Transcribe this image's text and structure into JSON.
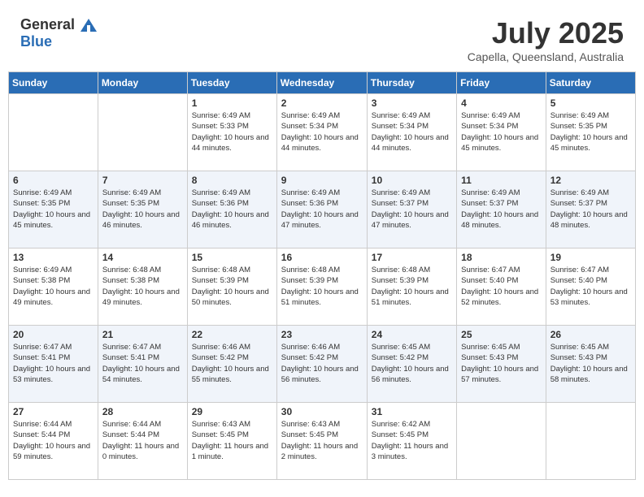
{
  "header": {
    "logo_general": "General",
    "logo_blue": "Blue",
    "month": "July 2025",
    "location": "Capella, Queensland, Australia"
  },
  "weekdays": [
    "Sunday",
    "Monday",
    "Tuesday",
    "Wednesday",
    "Thursday",
    "Friday",
    "Saturday"
  ],
  "weeks": [
    [
      {
        "day": "",
        "info": ""
      },
      {
        "day": "",
        "info": ""
      },
      {
        "day": "1",
        "info": "Sunrise: 6:49 AM\nSunset: 5:33 PM\nDaylight: 10 hours and 44 minutes."
      },
      {
        "day": "2",
        "info": "Sunrise: 6:49 AM\nSunset: 5:34 PM\nDaylight: 10 hours and 44 minutes."
      },
      {
        "day": "3",
        "info": "Sunrise: 6:49 AM\nSunset: 5:34 PM\nDaylight: 10 hours and 44 minutes."
      },
      {
        "day": "4",
        "info": "Sunrise: 6:49 AM\nSunset: 5:34 PM\nDaylight: 10 hours and 45 minutes."
      },
      {
        "day": "5",
        "info": "Sunrise: 6:49 AM\nSunset: 5:35 PM\nDaylight: 10 hours and 45 minutes."
      }
    ],
    [
      {
        "day": "6",
        "info": "Sunrise: 6:49 AM\nSunset: 5:35 PM\nDaylight: 10 hours and 45 minutes."
      },
      {
        "day": "7",
        "info": "Sunrise: 6:49 AM\nSunset: 5:35 PM\nDaylight: 10 hours and 46 minutes."
      },
      {
        "day": "8",
        "info": "Sunrise: 6:49 AM\nSunset: 5:36 PM\nDaylight: 10 hours and 46 minutes."
      },
      {
        "day": "9",
        "info": "Sunrise: 6:49 AM\nSunset: 5:36 PM\nDaylight: 10 hours and 47 minutes."
      },
      {
        "day": "10",
        "info": "Sunrise: 6:49 AM\nSunset: 5:37 PM\nDaylight: 10 hours and 47 minutes."
      },
      {
        "day": "11",
        "info": "Sunrise: 6:49 AM\nSunset: 5:37 PM\nDaylight: 10 hours and 48 minutes."
      },
      {
        "day": "12",
        "info": "Sunrise: 6:49 AM\nSunset: 5:37 PM\nDaylight: 10 hours and 48 minutes."
      }
    ],
    [
      {
        "day": "13",
        "info": "Sunrise: 6:49 AM\nSunset: 5:38 PM\nDaylight: 10 hours and 49 minutes."
      },
      {
        "day": "14",
        "info": "Sunrise: 6:48 AM\nSunset: 5:38 PM\nDaylight: 10 hours and 49 minutes."
      },
      {
        "day": "15",
        "info": "Sunrise: 6:48 AM\nSunset: 5:39 PM\nDaylight: 10 hours and 50 minutes."
      },
      {
        "day": "16",
        "info": "Sunrise: 6:48 AM\nSunset: 5:39 PM\nDaylight: 10 hours and 51 minutes."
      },
      {
        "day": "17",
        "info": "Sunrise: 6:48 AM\nSunset: 5:39 PM\nDaylight: 10 hours and 51 minutes."
      },
      {
        "day": "18",
        "info": "Sunrise: 6:47 AM\nSunset: 5:40 PM\nDaylight: 10 hours and 52 minutes."
      },
      {
        "day": "19",
        "info": "Sunrise: 6:47 AM\nSunset: 5:40 PM\nDaylight: 10 hours and 53 minutes."
      }
    ],
    [
      {
        "day": "20",
        "info": "Sunrise: 6:47 AM\nSunset: 5:41 PM\nDaylight: 10 hours and 53 minutes."
      },
      {
        "day": "21",
        "info": "Sunrise: 6:47 AM\nSunset: 5:41 PM\nDaylight: 10 hours and 54 minutes."
      },
      {
        "day": "22",
        "info": "Sunrise: 6:46 AM\nSunset: 5:42 PM\nDaylight: 10 hours and 55 minutes."
      },
      {
        "day": "23",
        "info": "Sunrise: 6:46 AM\nSunset: 5:42 PM\nDaylight: 10 hours and 56 minutes."
      },
      {
        "day": "24",
        "info": "Sunrise: 6:45 AM\nSunset: 5:42 PM\nDaylight: 10 hours and 56 minutes."
      },
      {
        "day": "25",
        "info": "Sunrise: 6:45 AM\nSunset: 5:43 PM\nDaylight: 10 hours and 57 minutes."
      },
      {
        "day": "26",
        "info": "Sunrise: 6:45 AM\nSunset: 5:43 PM\nDaylight: 10 hours and 58 minutes."
      }
    ],
    [
      {
        "day": "27",
        "info": "Sunrise: 6:44 AM\nSunset: 5:44 PM\nDaylight: 10 hours and 59 minutes."
      },
      {
        "day": "28",
        "info": "Sunrise: 6:44 AM\nSunset: 5:44 PM\nDaylight: 11 hours and 0 minutes."
      },
      {
        "day": "29",
        "info": "Sunrise: 6:43 AM\nSunset: 5:45 PM\nDaylight: 11 hours and 1 minute."
      },
      {
        "day": "30",
        "info": "Sunrise: 6:43 AM\nSunset: 5:45 PM\nDaylight: 11 hours and 2 minutes."
      },
      {
        "day": "31",
        "info": "Sunrise: 6:42 AM\nSunset: 5:45 PM\nDaylight: 11 hours and 3 minutes."
      },
      {
        "day": "",
        "info": ""
      },
      {
        "day": "",
        "info": ""
      }
    ]
  ]
}
